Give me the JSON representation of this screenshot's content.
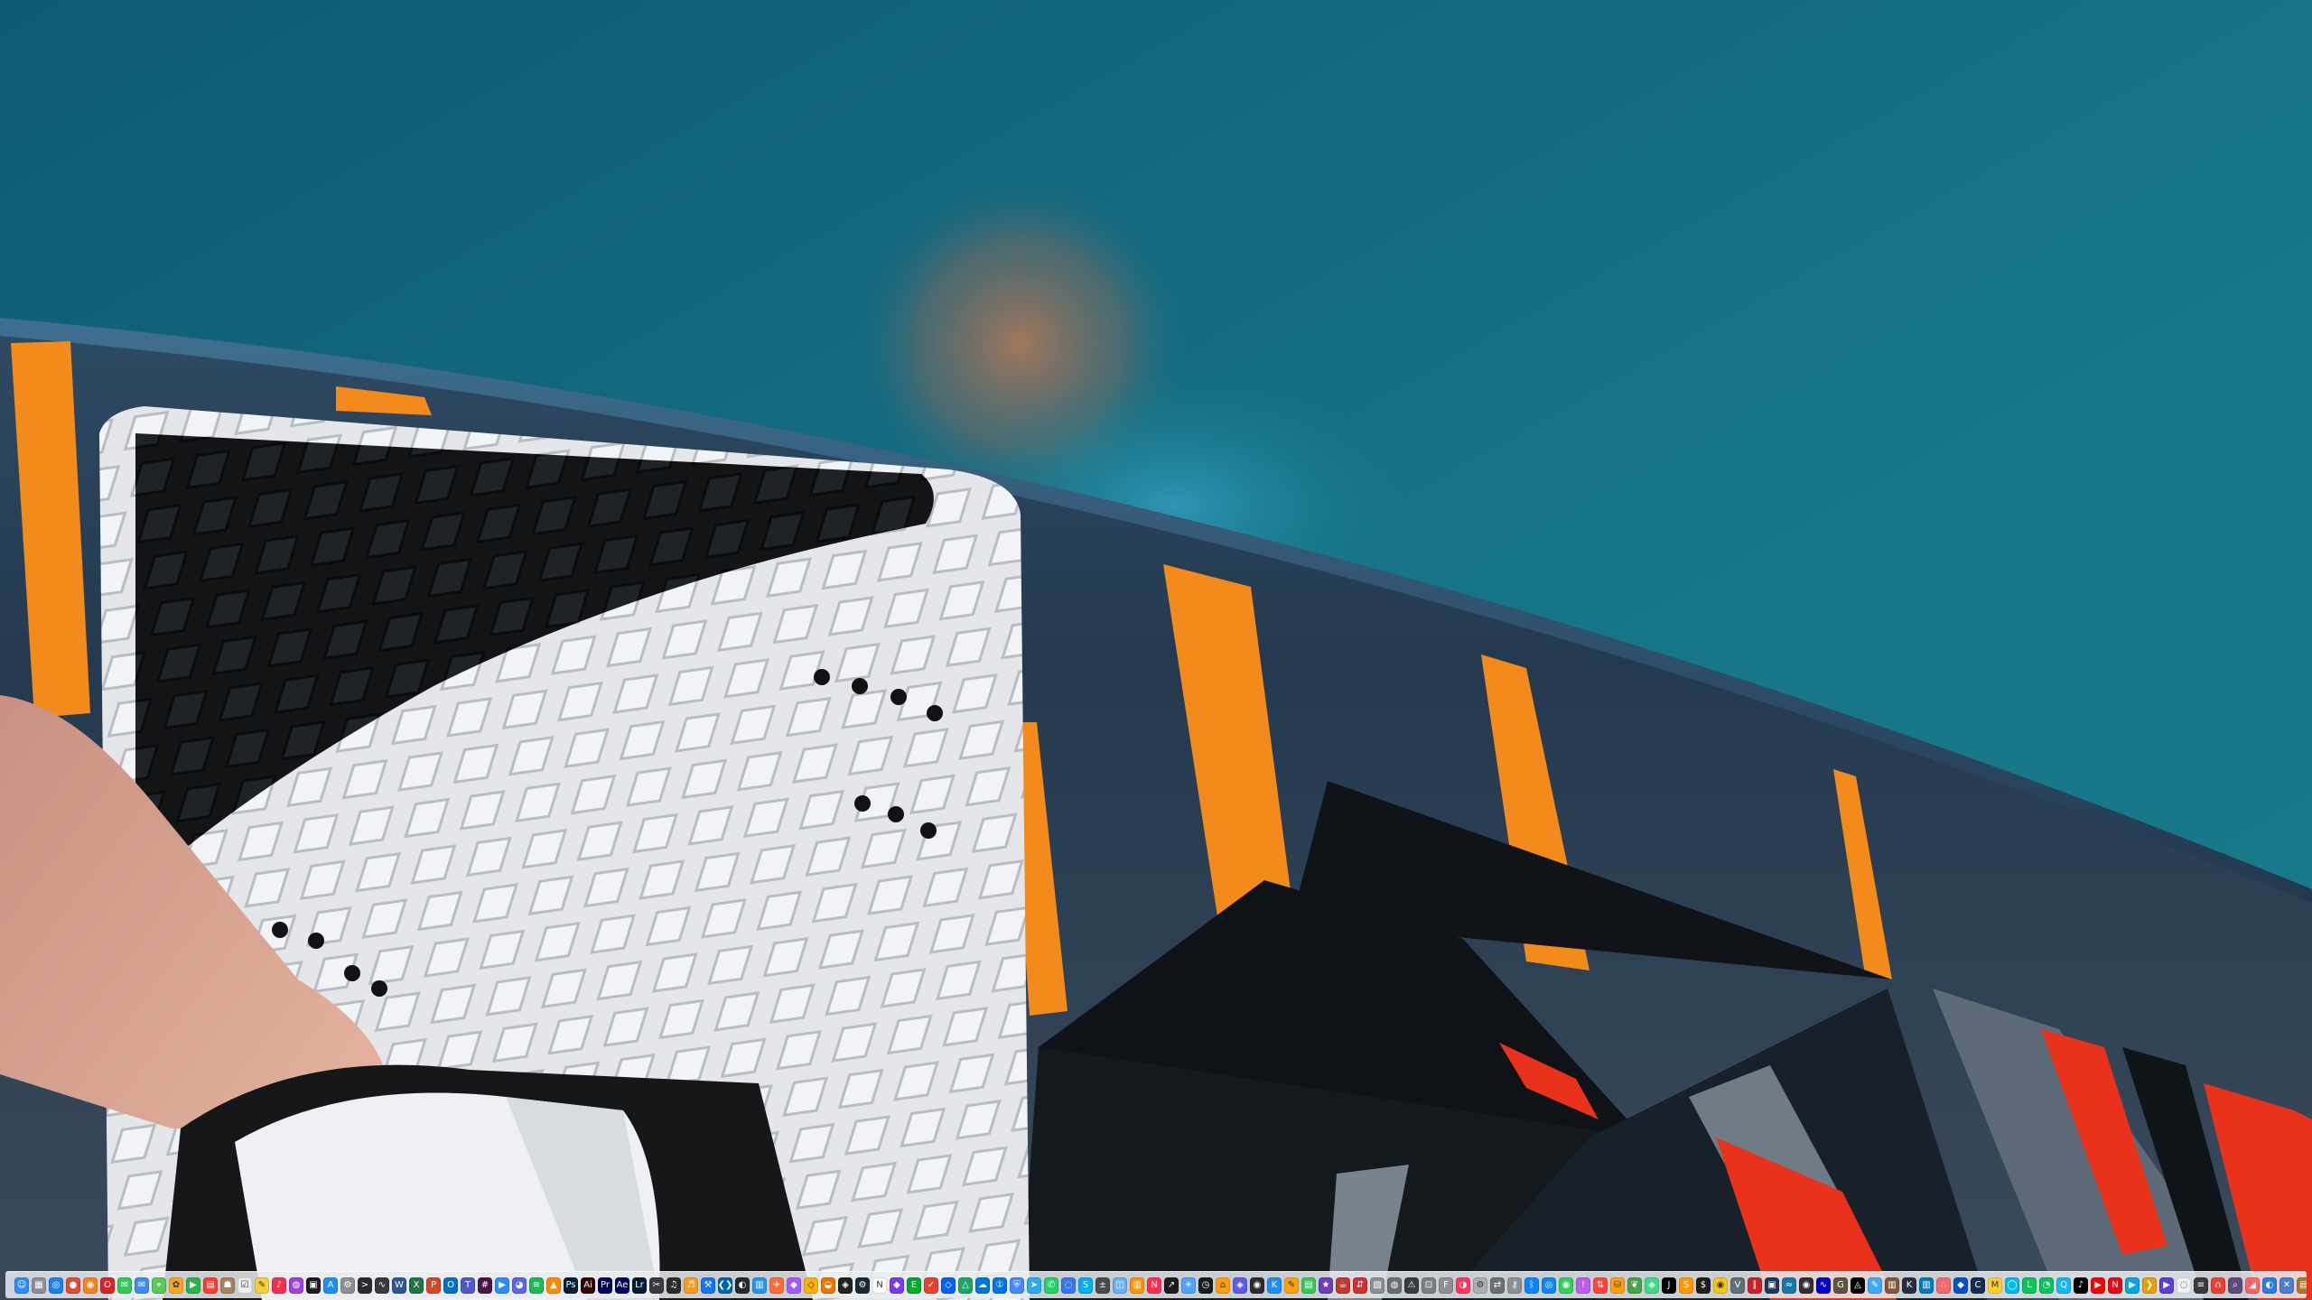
{
  "desktop": {
    "wallpaper": "water-sports-board-photo",
    "colors": {
      "water": "#137186",
      "board": "#24394d",
      "orange": "#f28a1c",
      "red": "#e8321c",
      "pad": "#e2e4e8"
    }
  },
  "dock": {
    "apps": [
      {
        "name": "finder-icon",
        "glyph": "☺",
        "color": "#2e8cf0"
      },
      {
        "name": "launchpad-icon",
        "glyph": "▦",
        "color": "#8a8f99"
      },
      {
        "name": "safari-icon",
        "glyph": "◎",
        "color": "#1c7ff0"
      },
      {
        "name": "chrome-icon",
        "glyph": "●",
        "color": "#dd4b39"
      },
      {
        "name": "firefox-icon",
        "glyph": "◉",
        "color": "#f58220"
      },
      {
        "name": "opera-icon",
        "glyph": "O",
        "color": "#d9222a"
      },
      {
        "name": "messages-icon",
        "glyph": "✉",
        "color": "#34c759"
      },
      {
        "name": "mail-icon",
        "glyph": "✉",
        "color": "#3b8df2"
      },
      {
        "name": "maps-icon",
        "glyph": "⌖",
        "color": "#5ac85a"
      },
      {
        "name": "photos-icon",
        "glyph": "✿",
        "color": "#f5a623"
      },
      {
        "name": "facetime-icon",
        "glyph": "▶",
        "color": "#2bb34b"
      },
      {
        "name": "calendar-icon",
        "glyph": "▤",
        "color": "#ff3b30"
      },
      {
        "name": "contacts-icon",
        "glyph": "☗",
        "color": "#a2845e"
      },
      {
        "name": "reminders-icon",
        "glyph": "☑",
        "color": "#f0f0f0"
      },
      {
        "name": "notes-icon",
        "glyph": "✎",
        "color": "#f7cf3b"
      },
      {
        "name": "music-icon",
        "glyph": "♪",
        "color": "#fa2d48"
      },
      {
        "name": "podcasts-icon",
        "glyph": "◍",
        "color": "#9b42d9"
      },
      {
        "name": "tv-icon",
        "glyph": "▣",
        "color": "#1c1c1e"
      },
      {
        "name": "app-store-icon",
        "glyph": "A",
        "color": "#1e8ef5"
      },
      {
        "name": "settings-icon",
        "glyph": "⚙",
        "color": "#8e8e93"
      },
      {
        "name": "terminal-icon",
        "glyph": ">",
        "color": "#2b2b2b"
      },
      {
        "name": "activity-monitor-icon",
        "glyph": "∿",
        "color": "#3a3a3c"
      },
      {
        "name": "word-icon",
        "glyph": "W",
        "color": "#2b579a"
      },
      {
        "name": "excel-icon",
        "glyph": "X",
        "color": "#217346"
      },
      {
        "name": "powerpoint-icon",
        "glyph": "P",
        "color": "#d24726"
      },
      {
        "name": "outlook-icon",
        "glyph": "O",
        "color": "#0072c6"
      },
      {
        "name": "teams-icon",
        "glyph": "T",
        "color": "#5059c9"
      },
      {
        "name": "slack-icon",
        "glyph": "#",
        "color": "#4a154b"
      },
      {
        "name": "zoom-icon",
        "glyph": "▶",
        "color": "#2d8cff"
      },
      {
        "name": "discord-icon",
        "glyph": "◕",
        "color": "#5865f2"
      },
      {
        "name": "spotify-icon",
        "glyph": "≋",
        "color": "#1db954"
      },
      {
        "name": "vlc-icon",
        "glyph": "▲",
        "color": "#ff8800"
      },
      {
        "name": "photoshop-icon",
        "glyph": "Ps",
        "color": "#001e36"
      },
      {
        "name": "illustrator-icon",
        "glyph": "Ai",
        "color": "#330000"
      },
      {
        "name": "premiere-icon",
        "glyph": "Pr",
        "color": "#00005b"
      },
      {
        "name": "after-effects-icon",
        "glyph": "Ae",
        "color": "#00005b"
      },
      {
        "name": "lightroom-icon",
        "glyph": "Lr",
        "color": "#001e36"
      },
      {
        "name": "final-cut-icon",
        "glyph": "✂",
        "color": "#3a3a3c"
      },
      {
        "name": "logic-icon",
        "glyph": "♫",
        "color": "#2b2b2b"
      },
      {
        "name": "garageband-icon",
        "glyph": "♬",
        "color": "#f29b1f"
      },
      {
        "name": "xcode-icon",
        "glyph": "⚒",
        "color": "#1575f9"
      },
      {
        "name": "vscode-icon",
        "glyph": "❮❯",
        "color": "#0065a9"
      },
      {
        "name": "github-icon",
        "glyph": "◐",
        "color": "#24292e"
      },
      {
        "name": "docker-icon",
        "glyph": "▥",
        "color": "#2496ed"
      },
      {
        "name": "postman-icon",
        "glyph": "✈",
        "color": "#ff6c37"
      },
      {
        "name": "figma-icon",
        "glyph": "◆",
        "color": "#a259ff"
      },
      {
        "name": "sketch-icon",
        "glyph": "◇",
        "color": "#fdb300"
      },
      {
        "name": "blender-icon",
        "glyph": "◒",
        "color": "#ea7600"
      },
      {
        "name": "unity-icon",
        "glyph": "◈",
        "color": "#222222"
      },
      {
        "name": "steam-icon",
        "glyph": "⚙",
        "color": "#1b2838"
      },
      {
        "name": "notion-icon",
        "glyph": "N",
        "color": "#ffffff"
      },
      {
        "name": "obsidian-icon",
        "glyph": "◆",
        "color": "#7c3aed"
      },
      {
        "name": "evernote-icon",
        "glyph": "E",
        "color": "#00a82d"
      },
      {
        "name": "todoist-icon",
        "glyph": "✓",
        "color": "#e44332"
      },
      {
        "name": "dropbox-icon",
        "glyph": "◇",
        "color": "#0061ff"
      },
      {
        "name": "google-drive-icon",
        "glyph": "△",
        "color": "#1fa463"
      },
      {
        "name": "onedrive-icon",
        "glyph": "☁",
        "color": "#0078d4"
      },
      {
        "name": "1password-icon",
        "glyph": "①",
        "color": "#0572ec"
      },
      {
        "name": "vpn-icon",
        "glyph": "⛨",
        "color": "#4687ff"
      },
      {
        "name": "telegram-icon",
        "glyph": "➤",
        "color": "#2aabee"
      },
      {
        "name": "whatsapp-icon",
        "glyph": "✆",
        "color": "#25d366"
      },
      {
        "name": "signal-icon",
        "glyph": "◌",
        "color": "#3a76f0"
      },
      {
        "name": "skype-icon",
        "glyph": "S",
        "color": "#00aff0"
      },
      {
        "name": "calculator-icon",
        "glyph": "±",
        "color": "#4a4a4c"
      },
      {
        "name": "preview-icon",
        "glyph": "◫",
        "color": "#6ab0f3"
      },
      {
        "name": "books-icon",
        "glyph": "▥",
        "color": "#ff9500"
      },
      {
        "name": "news-icon",
        "glyph": "N",
        "color": "#ff2d55"
      },
      {
        "name": "stocks-icon",
        "glyph": "↗",
        "color": "#1c1c1e"
      },
      {
        "name": "weather-icon",
        "glyph": "☀",
        "color": "#4fa3f7"
      },
      {
        "name": "clock-icon",
        "glyph": "◷",
        "color": "#1c1c1e"
      },
      {
        "name": "home-icon",
        "glyph": "⌂",
        "color": "#ff9f0a"
      },
      {
        "name": "shortcuts-icon",
        "glyph": "◈",
        "color": "#5e5ce6"
      },
      {
        "name": "voice-memos-icon",
        "glyph": "◉",
        "color": "#2c2c2e"
      },
      {
        "name": "keynote-icon",
        "glyph": "K",
        "color": "#1d8cf8"
      },
      {
        "name": "pages-icon",
        "glyph": "✎",
        "color": "#ff9f0a"
      },
      {
        "name": "numbers-icon",
        "glyph": "▤",
        "color": "#34c759"
      },
      {
        "name": "imovie-icon",
        "glyph": "★",
        "color": "#6e3cbc"
      },
      {
        "name": "handbrake-icon",
        "glyph": "☕",
        "color": "#c0392b"
      },
      {
        "name": "transmission-icon",
        "glyph": "⇵",
        "color": "#cf3131"
      },
      {
        "name": "archive-utility-icon",
        "glyph": "▧",
        "color": "#8e8e93"
      },
      {
        "name": "disk-utility-icon",
        "glyph": "◍",
        "color": "#6d6d72"
      },
      {
        "name": "console-icon",
        "glyph": "⚠",
        "color": "#3a3a3c"
      },
      {
        "name": "screenshot-icon",
        "glyph": "⊡",
        "color": "#7d7d82"
      },
      {
        "name": "font-book-icon",
        "glyph": "F",
        "color": "#8e8e93"
      },
      {
        "name": "color-picker-icon",
        "glyph": "◑",
        "color": "#ff375f"
      },
      {
        "name": "automator-icon",
        "glyph": "⚙",
        "color": "#aeaeb2"
      },
      {
        "name": "migration-icon",
        "glyph": "⇄",
        "color": "#6e6e73"
      },
      {
        "name": "keychain-icon",
        "glyph": "⚷",
        "color": "#8e8e93"
      },
      {
        "name": "bluetooth-icon",
        "glyph": "ᛒ",
        "color": "#0a84ff"
      },
      {
        "name": "airdrop-icon",
        "glyph": "◎",
        "color": "#0a84ff"
      },
      {
        "name": "find-my-icon",
        "glyph": "◉",
        "color": "#30d158"
      },
      {
        "name": "feedback-icon",
        "glyph": "!",
        "color": "#bf5af2"
      },
      {
        "name": "ftp-icon",
        "glyph": "⇅",
        "color": "#ff453a"
      },
      {
        "name": "database-icon",
        "glyph": "⛁",
        "color": "#ff9f0a"
      },
      {
        "name": "mongodb-icon",
        "glyph": "❦",
        "color": "#47a248"
      },
      {
        "name": "android-studio-icon",
        "glyph": "◈",
        "color": "#3ddc84"
      },
      {
        "name": "jetbrains-icon",
        "glyph": "J",
        "color": "#000000"
      },
      {
        "name": "sublime-icon",
        "glyph": "S",
        "color": "#ff9800"
      },
      {
        "name": "iterm-icon",
        "glyph": "$",
        "color": "#1d1d1d"
      },
      {
        "name": "cyberduck-icon",
        "glyph": "◉",
        "color": "#f5c518"
      },
      {
        "name": "vmware-icon",
        "glyph": "V",
        "color": "#607078"
      },
      {
        "name": "parallels-icon",
        "glyph": "∥",
        "color": "#cc1f26"
      },
      {
        "name": "virtualbox-icon",
        "glyph": "▣",
        "color": "#183a61"
      },
      {
        "name": "wireshark-icon",
        "glyph": "≈",
        "color": "#1679a7"
      },
      {
        "name": "obs-icon",
        "glyph": "◉",
        "color": "#302e31"
      },
      {
        "name": "audacity-icon",
        "glyph": "∿",
        "color": "#0000cc"
      },
      {
        "name": "gimp-icon",
        "glyph": "G",
        "color": "#5c5543"
      },
      {
        "name": "inkscape-icon",
        "glyph": "◬",
        "color": "#000000"
      },
      {
        "name": "krita-icon",
        "glyph": "✎",
        "color": "#3babff"
      },
      {
        "name": "calibre-icon",
        "glyph": "▥",
        "color": "#7f5a3a"
      },
      {
        "name": "kindle-icon",
        "glyph": "K",
        "color": "#232f3e"
      },
      {
        "name": "trello-icon",
        "glyph": "▥",
        "color": "#0079bf"
      },
      {
        "name": "asana-icon",
        "glyph": "∴",
        "color": "#f06a6a"
      },
      {
        "name": "jira-icon",
        "glyph": "◆",
        "color": "#0052cc"
      },
      {
        "name": "confluence-icon",
        "glyph": "C",
        "color": "#172b4d"
      },
      {
        "name": "miro-icon",
        "glyph": "M",
        "color": "#ffd02f"
      },
      {
        "name": "webex-icon",
        "glyph": "◯",
        "color": "#00bceb"
      },
      {
        "name": "line-icon",
        "glyph": "L",
        "color": "#06c755"
      },
      {
        "name": "wechat-icon",
        "glyph": "◔",
        "color": "#07c160"
      },
      {
        "name": "qq-icon",
        "glyph": "Q",
        "color": "#12b7f5"
      },
      {
        "name": "tiktok-icon",
        "glyph": "♪",
        "color": "#010101"
      },
      {
        "name": "youtube-icon",
        "glyph": "▶",
        "color": "#ff0000"
      },
      {
        "name": "netflix-icon",
        "glyph": "N",
        "color": "#e50914"
      },
      {
        "name": "prime-video-icon",
        "glyph": "▶",
        "color": "#00a8e1"
      },
      {
        "name": "plex-icon",
        "glyph": "❯",
        "color": "#e5a00d"
      },
      {
        "name": "iina-icon",
        "glyph": "▶",
        "color": "#5b3fd6"
      },
      {
        "name": "amphetamine-icon",
        "glyph": "◌",
        "color": "#f0f0f0"
      },
      {
        "name": "bartender-icon",
        "glyph": "≡",
        "color": "#3b3b3b"
      },
      {
        "name": "magnet-icon",
        "glyph": "∩",
        "color": "#e94235"
      },
      {
        "name": "alfred-icon",
        "glyph": "⌕",
        "color": "#5d4a7a"
      },
      {
        "name": "raycast-icon",
        "glyph": "◢",
        "color": "#ff6363"
      },
      {
        "name": "cleanmymac-icon",
        "glyph": "◐",
        "color": "#2a7ce8"
      },
      {
        "name": "appcleaner-icon",
        "glyph": "✕",
        "color": "#4d7ec9"
      },
      {
        "name": "the-unarchiver-icon",
        "glyph": "▤",
        "color": "#b0772d"
      }
    ],
    "trailing": [
      {
        "name": "downloads-stack-icon",
        "glyph": "↓",
        "color": "#6d8fb3"
      },
      {
        "name": "documents-stack-icon",
        "glyph": "▤",
        "color": "#8aa4c1"
      },
      {
        "name": "recent-stack-icon",
        "glyph": "◷",
        "color": "#9db5cf"
      },
      {
        "name": "trash-icon",
        "glyph": "🗑",
        "color": "#b8bcc2"
      }
    ]
  }
}
